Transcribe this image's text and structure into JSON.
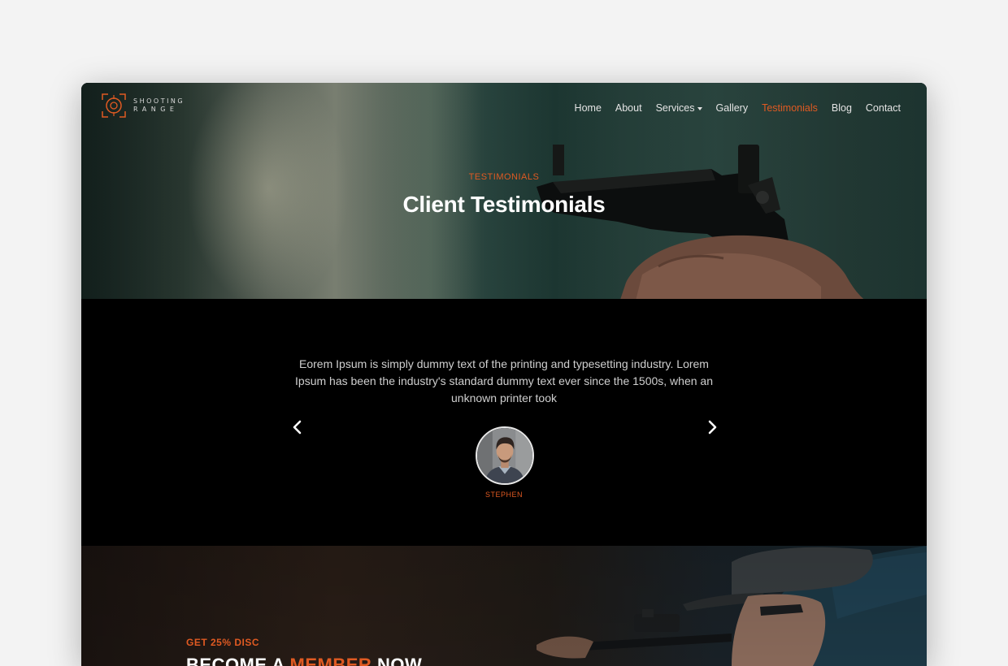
{
  "brand": {
    "line1": "SHOOTING",
    "line2": "RANGE"
  },
  "nav": {
    "items": [
      {
        "label": "Home"
      },
      {
        "label": "About"
      },
      {
        "label": "Services"
      },
      {
        "label": "Gallery"
      },
      {
        "label": "Testimonials"
      },
      {
        "label": "Blog"
      },
      {
        "label": "Contact"
      }
    ],
    "active": "Testimonials"
  },
  "hero": {
    "kicker": "TESTIMONIALS",
    "title": "Client Testimonials"
  },
  "testimonial": {
    "quote": "Eorem Ipsum is simply dummy text of the printing and typesetting industry. Lorem Ipsum has been the industry's standard dummy text ever since the 1500s, when an unknown printer took",
    "name": "STEPHEN"
  },
  "member": {
    "kicker": "GET 25% DISC",
    "title_part1": "BECOME A ",
    "title_accent": "MEMBER",
    "title_part2": " NOW"
  },
  "colors": {
    "accent": "#e05a22",
    "background": "#f3f3f3",
    "section_dark": "#000000"
  },
  "icons": {
    "logo": "target-crosshair-icon",
    "caret": "caret-down-icon",
    "prev": "chevron-left-icon",
    "next": "chevron-right-icon"
  }
}
